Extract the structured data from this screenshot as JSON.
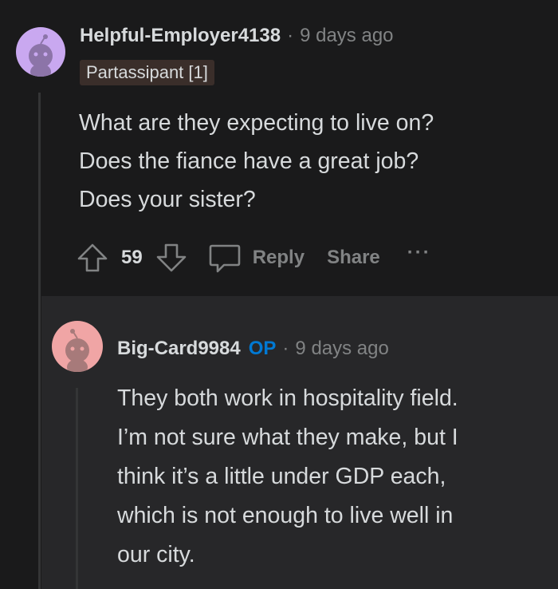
{
  "comment": {
    "username": "Helpful-Employer4138",
    "separator": "·",
    "time": "9 days ago",
    "flair": "Partassipant [1]",
    "body_lines": [
      "What are they expecting to live on?",
      "Does the fiance have a great job?",
      "Does your sister?"
    ],
    "vote_count": "59",
    "reply_label": "Reply",
    "share_label": "Share",
    "more_label": "···"
  },
  "reply": {
    "username": "Big-Card9984",
    "op_badge": "OP",
    "separator": "·",
    "time": "9 days ago",
    "body_lines": [
      "They both work in hospitality field.",
      "I’m not sure what they make, but I",
      "think it’s a little under GDP each,",
      "which is not enough to live well in",
      "our city."
    ]
  },
  "colors": {
    "background": "#1a1a1b",
    "reply_background": "#272729",
    "avatar1": "#c9a8f0",
    "avatar2": "#f0a5a5",
    "op_blue": "#0079d3",
    "flair_bg": "#3a2e2a"
  }
}
